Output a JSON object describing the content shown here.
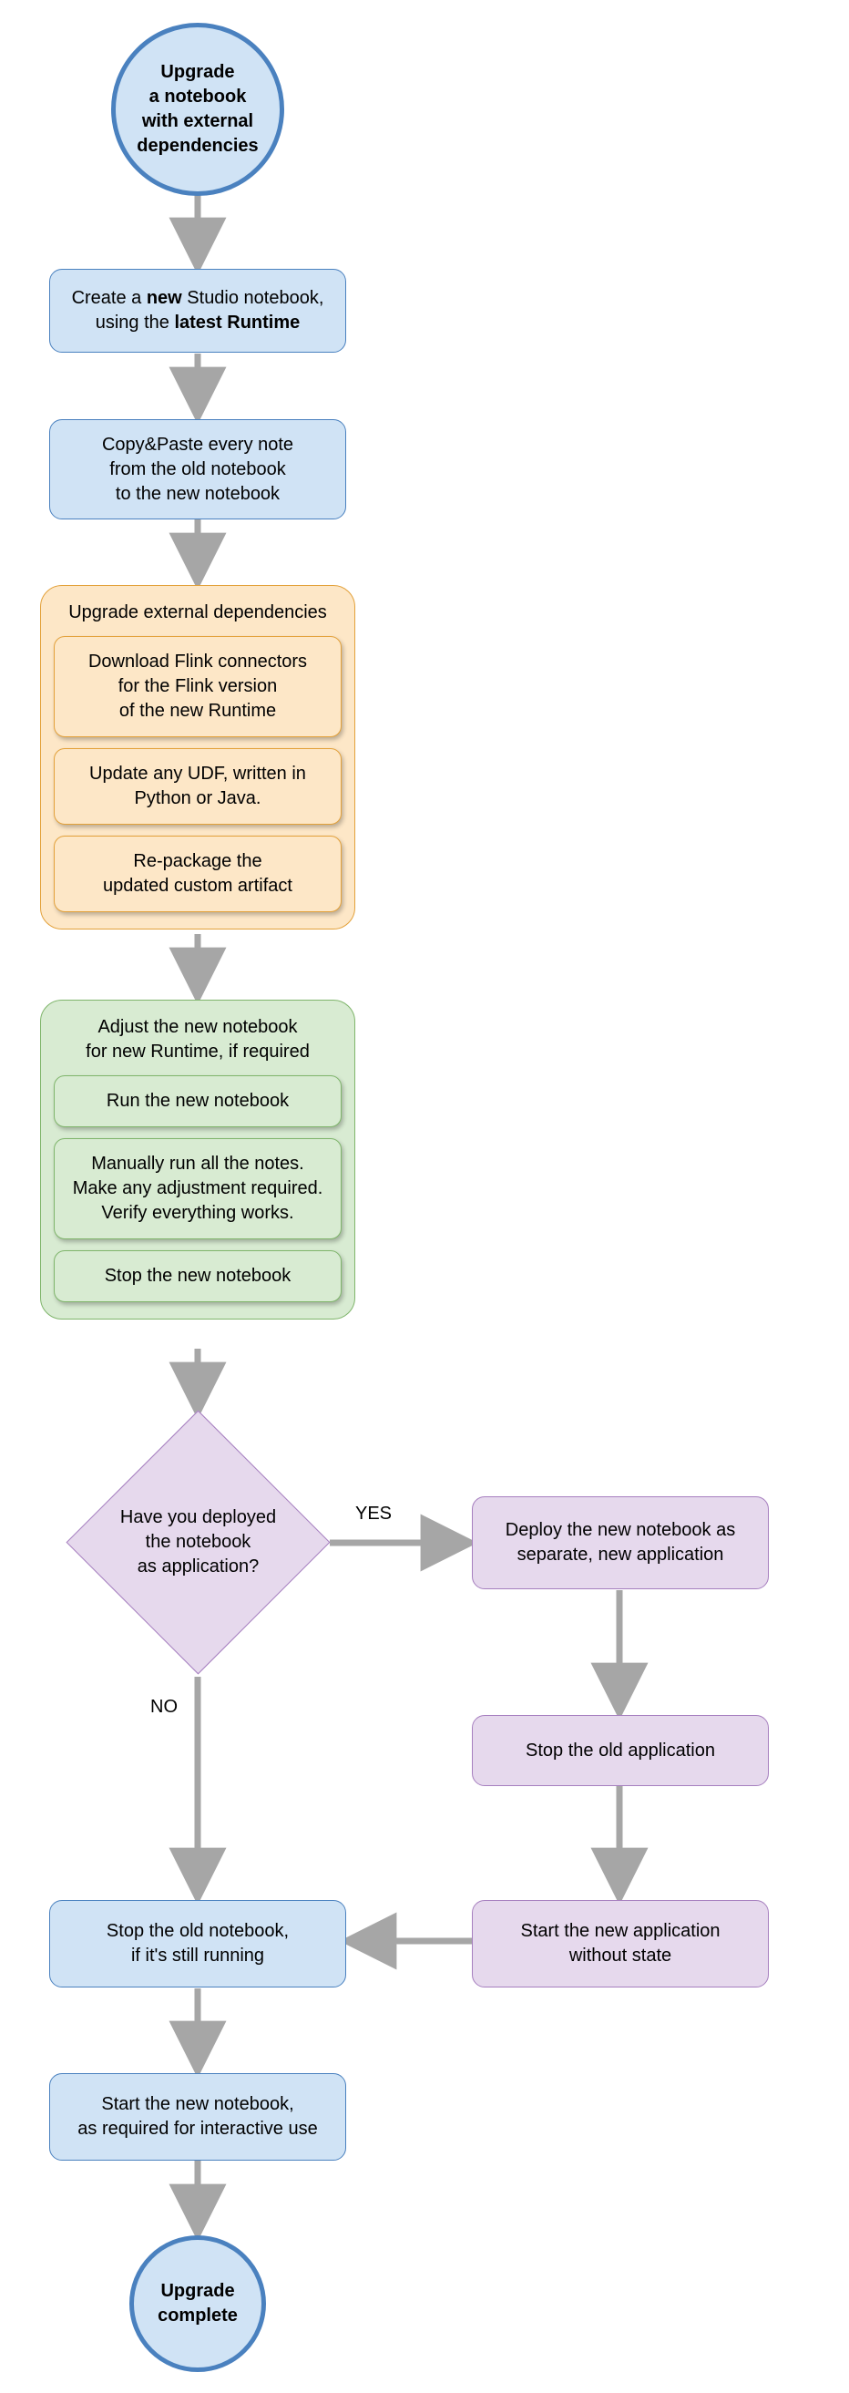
{
  "nodes": {
    "start": "Upgrade\na notebook\nwith external\ndependencies",
    "create": {
      "pre": "Create a ",
      "bold1": "new",
      "mid": " Studio notebook,\nusing the ",
      "bold2": "latest Runtime"
    },
    "copy": "Copy&Paste every note\nfrom the old notebook\nto the new notebook",
    "orange_title": "Upgrade external dependencies",
    "orange_1": "Download Flink connectors\nfor the Flink version\nof the new Runtime",
    "orange_2": "Update any UDF, written in\nPython or Java.",
    "orange_3": "Re-package the\nupdated custom artifact",
    "green_title": "Adjust the new notebook\nfor new Runtime, if required",
    "green_1": "Run the new notebook",
    "green_2": "Manually run all the notes.\nMake any adjustment required.\nVerify everything works.",
    "green_3": "Stop the new notebook",
    "decision": "Have you deployed\nthe notebook\nas application?",
    "deploy_new": "Deploy the new notebook as\nseparate, new application",
    "stop_old_app": "Stop the old application",
    "start_new_app": "Start the new application\nwithout state",
    "stop_old_nb": "Stop the old notebook,\nif it's still running",
    "start_new_nb": "Start the new notebook,\nas required for interactive use",
    "end": "Upgrade\ncomplete"
  },
  "edges": {
    "yes": "YES",
    "no": "NO"
  },
  "colors": {
    "blue_fill": "#d0e3f5",
    "blue_stroke": "#4a81bf",
    "orange_fill": "#fde7c7",
    "orange_stroke": "#e3a13a",
    "green_fill": "#d8ebd2",
    "green_stroke": "#7fb56b",
    "purple_fill": "#e6d9ed",
    "purple_stroke": "#a67fbf",
    "arrow": "#a6a6a6"
  }
}
